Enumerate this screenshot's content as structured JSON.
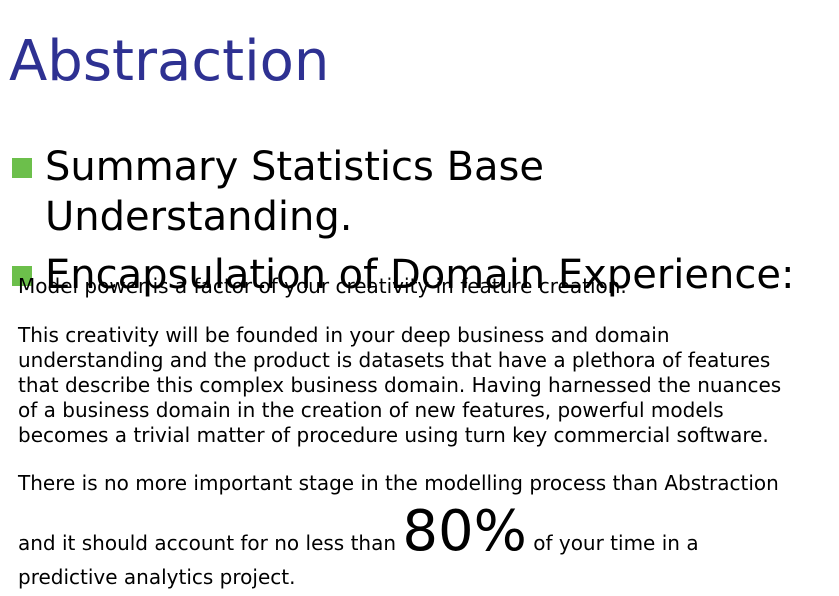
{
  "slide": {
    "title": "Abstraction",
    "bullets": [
      "Summary Statistics Base",
      "Understanding.",
      "Encapsulation of Domain Experience:"
    ],
    "paragraph1": "Model power is a factor of your creativity in feature creation.",
    "paragraph2_lines": [
      "This creativity will be founded in your deep business and domain",
      "understanding and the product is datasets that have a plethora of features",
      "that describe this complex business domain.  Having harnessed the nuances",
      "of a business domain in the creation of new features, powerful models",
      "becomes a trivial matter of procedure using turn key commercial software."
    ],
    "paragraph3_line1": "There is no more important stage in the modelling process than Abstraction",
    "paragraph3_line2_before": "and it should account for no less than ",
    "paragraph3_highlight": "80%",
    "paragraph3_line2_after": " of your time in a",
    "paragraph3_line3": "predictive analytics project."
  },
  "colors": {
    "title": "#2e3192",
    "bullet": "#6cbf4b",
    "text": "#000000",
    "background": "#ffffff"
  }
}
